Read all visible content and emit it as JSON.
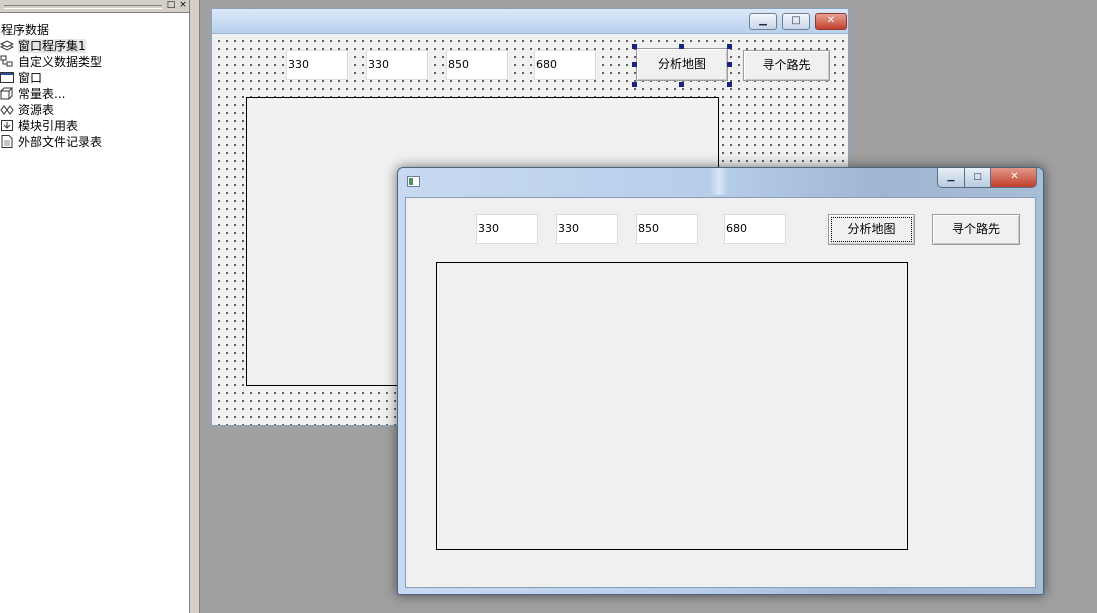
{
  "program_tree": {
    "root_label": "程序数据",
    "items": [
      {
        "label": "窗口程序集1",
        "icon": "assembly-icon",
        "selected": true
      },
      {
        "label": "自定义数据类型",
        "icon": "data-type-icon"
      },
      {
        "label": "窗口",
        "icon": "window-icon"
      },
      {
        "label": "常量表...",
        "icon": "constant-table-icon"
      },
      {
        "label": "资源表",
        "icon": "resource-table-icon"
      },
      {
        "label": "模块引用表",
        "icon": "module-reference-icon"
      },
      {
        "label": "外部文件记录表",
        "icon": "external-file-icon"
      }
    ],
    "header_buttons": {
      "restore": "□",
      "close": "×"
    }
  },
  "design_form": {
    "caption_buttons": {
      "minimize": "▁",
      "maximize": "□",
      "close": "✕"
    },
    "fields": [
      "330",
      "330",
      "850",
      "680"
    ],
    "analyze_button": "分析地图",
    "find_path_button": "寻个路先"
  },
  "run_window": {
    "caption_buttons": {
      "minimize": "▁",
      "maximize": "□",
      "close": "✕"
    },
    "fields": [
      "330",
      "330",
      "850",
      "680"
    ],
    "analyze_button": "分析地图",
    "find_path_button": "寻个路先"
  },
  "colors": {
    "desktop": "#a0a0a0",
    "close_button": "#c2402b",
    "title_bar": "#b6cde9",
    "selection_handle": "#1a237e"
  }
}
